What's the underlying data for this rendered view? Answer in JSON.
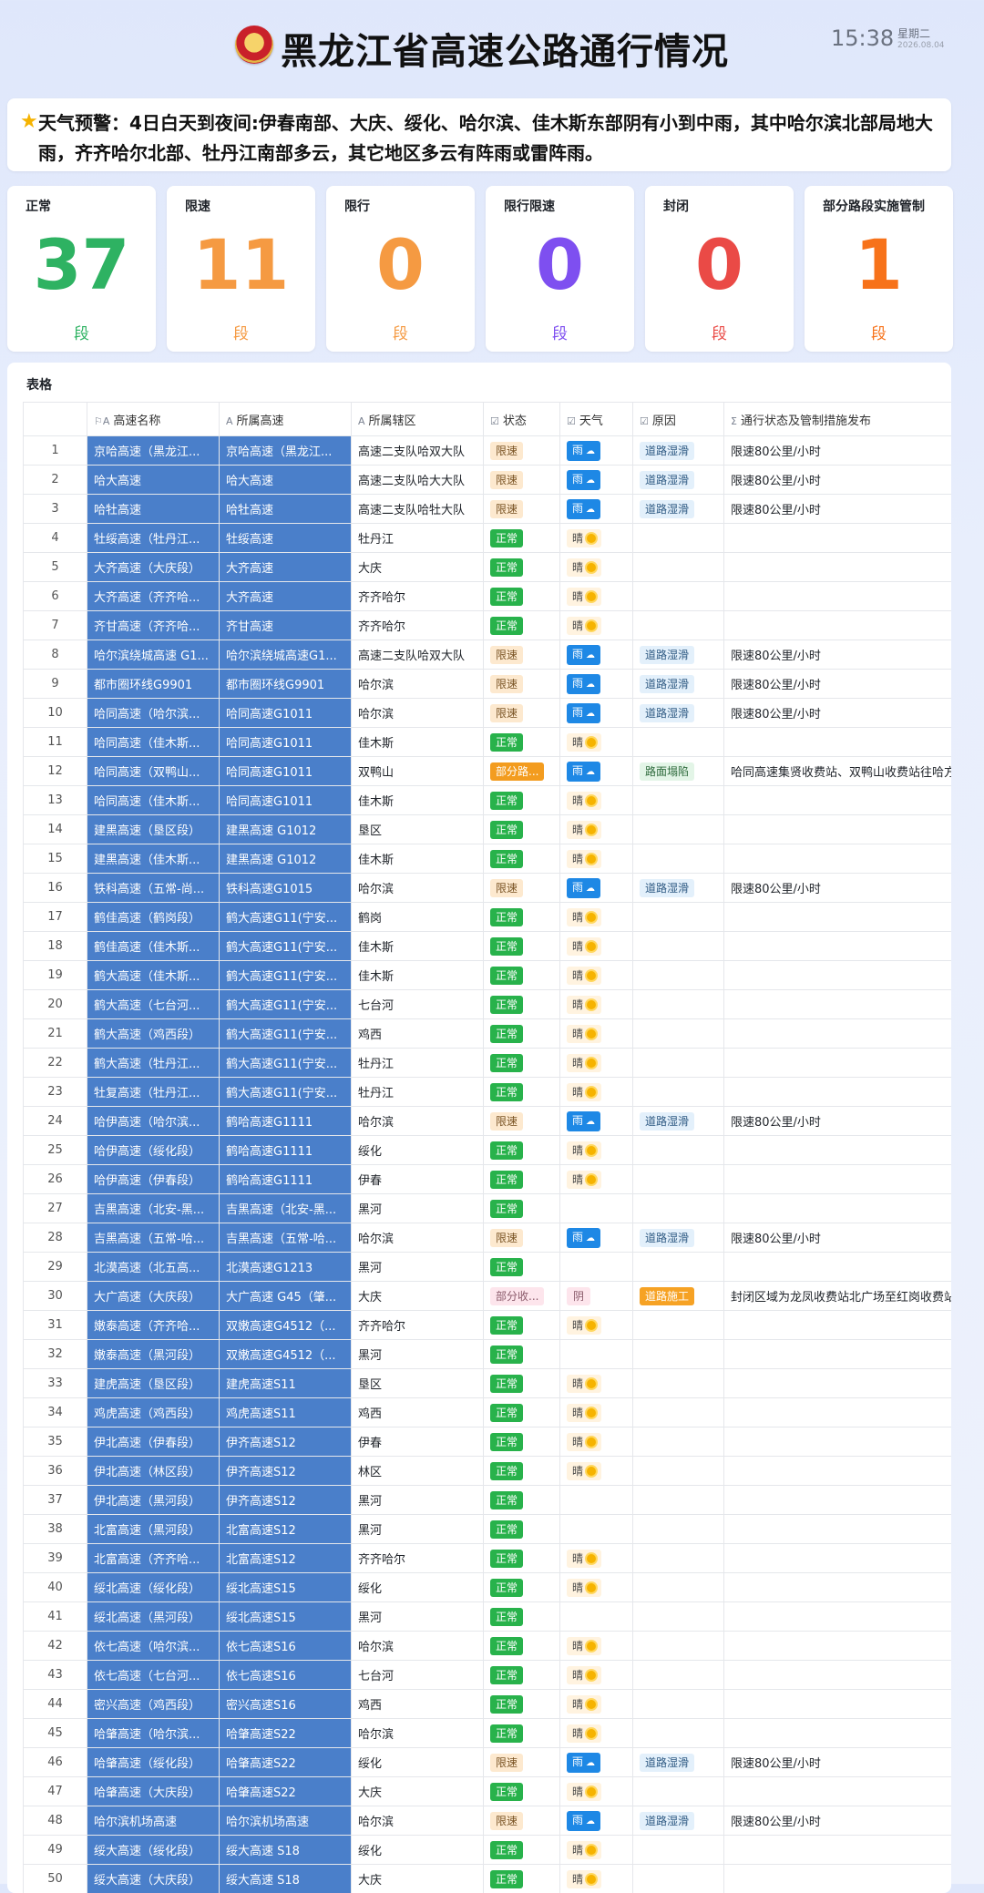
{
  "header": {
    "title": "黑龙江省高速公路通行情况",
    "time": "15:38",
    "weekday": "星期二",
    "date": "2026.08.04"
  },
  "alert": {
    "text": "天气预警：4日白天到夜间:伊春南部、大庆、绥化、哈尔滨、佳木斯东部阴有小到中雨，其中哈尔滨北部局地大雨，齐齐哈尔北部、牡丹江南部多云，其它地区多云有阵雨或雷阵雨。"
  },
  "stats": [
    {
      "label": "正常",
      "value": "37",
      "unit": "段",
      "color": "#2eb262"
    },
    {
      "label": "限速",
      "value": "11",
      "unit": "段",
      "color": "#f59a42"
    },
    {
      "label": "限行",
      "value": "0",
      "unit": "段",
      "color": "#f59a42"
    },
    {
      "label": "限行限速",
      "value": "0",
      "unit": "段",
      "color": "#7e4ff0"
    },
    {
      "label": "封闭",
      "value": "0",
      "unit": "段",
      "color": "#ea4a46"
    },
    {
      "label": "部分路段实施管制",
      "value": "1",
      "unit": "段",
      "color": "#f7721a"
    }
  ],
  "table": {
    "title": "表格",
    "headers": [
      "高速名称",
      "所属高速",
      "所属辖区",
      "状态",
      "天气",
      "原因",
      "通行状态及管制措施发布"
    ],
    "rows": [
      [
        "1",
        "京哈高速（黑龙江...",
        "京哈高速（黑龙江...",
        "高速二支队哈双大队",
        "限速",
        "雨",
        "道路湿滑",
        "限速80公里/小时"
      ],
      [
        "2",
        "哈大高速",
        "哈大高速",
        "高速二支队哈大大队",
        "限速",
        "雨",
        "道路湿滑",
        "限速80公里/小时"
      ],
      [
        "3",
        "哈牡高速",
        "哈牡高速",
        "高速二支队哈牡大队",
        "限速",
        "雨",
        "道路湿滑",
        "限速80公里/小时"
      ],
      [
        "4",
        "牡绥高速（牡丹江...",
        "牡绥高速",
        "牡丹江",
        "正常",
        "晴",
        "",
        ""
      ],
      [
        "5",
        "大齐高速（大庆段）",
        "大齐高速",
        "大庆",
        "正常",
        "晴",
        "",
        ""
      ],
      [
        "6",
        "大齐高速（齐齐哈...",
        "大齐高速",
        "齐齐哈尔",
        "正常",
        "晴",
        "",
        ""
      ],
      [
        "7",
        "齐甘高速（齐齐哈...",
        "齐甘高速",
        "齐齐哈尔",
        "正常",
        "晴",
        "",
        ""
      ],
      [
        "8",
        "哈尔滨绕城高速 G1...",
        "哈尔滨绕城高速G1...",
        "高速二支队哈双大队",
        "限速",
        "雨",
        "道路湿滑",
        "限速80公里/小时"
      ],
      [
        "9",
        "都市圈环线G9901",
        "都市圈环线G9901",
        "哈尔滨",
        "限速",
        "雨",
        "道路湿滑",
        "限速80公里/小时"
      ],
      [
        "10",
        "哈同高速（哈尔滨...",
        "哈同高速G1011",
        "哈尔滨",
        "限速",
        "雨",
        "道路湿滑",
        "限速80公里/小时"
      ],
      [
        "11",
        "哈同高速（佳木斯...",
        "哈同高速G1011",
        "佳木斯",
        "正常",
        "晴",
        "",
        ""
      ],
      [
        "12",
        "哈同高速（双鸭山...",
        "哈同高速G1011",
        "双鸭山",
        "部分路...",
        "雨",
        "路面塌陷",
        "哈同高速集贤收费站、双鸭山收费站往哈方向"
      ],
      [
        "13",
        "哈同高速（佳木斯...",
        "哈同高速G1011",
        "佳木斯",
        "正常",
        "晴",
        "",
        ""
      ],
      [
        "14",
        "建黑高速（垦区段）",
        "建黑高速 G1012",
        "垦区",
        "正常",
        "晴",
        "",
        ""
      ],
      [
        "15",
        "建黑高速（佳木斯...",
        "建黑高速 G1012",
        "佳木斯",
        "正常",
        "晴",
        "",
        ""
      ],
      [
        "16",
        "铁科高速（五常-尚...",
        "铁科高速G1015",
        "哈尔滨",
        "限速",
        "雨",
        "道路湿滑",
        "限速80公里/小时"
      ],
      [
        "17",
        "鹤佳高速（鹤岗段）",
        "鹤大高速G11(宁安...",
        "鹤岗",
        "正常",
        "晴",
        "",
        ""
      ],
      [
        "18",
        "鹤佳高速（佳木斯...",
        "鹤大高速G11(宁安...",
        "佳木斯",
        "正常",
        "晴",
        "",
        ""
      ],
      [
        "19",
        "鹤大高速（佳木斯...",
        "鹤大高速G11(宁安...",
        "佳木斯",
        "正常",
        "晴",
        "",
        ""
      ],
      [
        "20",
        "鹤大高速（七台河...",
        "鹤大高速G11(宁安...",
        "七台河",
        "正常",
        "晴",
        "",
        ""
      ],
      [
        "21",
        "鹤大高速（鸡西段）",
        "鹤大高速G11(宁安...",
        "鸡西",
        "正常",
        "晴",
        "",
        ""
      ],
      [
        "22",
        "鹤大高速（牡丹江...",
        "鹤大高速G11(宁安...",
        "牡丹江",
        "正常",
        "晴",
        "",
        ""
      ],
      [
        "23",
        "牡复高速（牡丹江...",
        "鹤大高速G11(宁安...",
        "牡丹江",
        "正常",
        "晴",
        "",
        ""
      ],
      [
        "24",
        "哈伊高速（哈尔滨...",
        "鹤哈高速G1111",
        "哈尔滨",
        "限速",
        "雨",
        "道路湿滑",
        "限速80公里/小时"
      ],
      [
        "25",
        "哈伊高速（绥化段）",
        "鹤哈高速G1111",
        "绥化",
        "正常",
        "晴",
        "",
        ""
      ],
      [
        "26",
        "哈伊高速（伊春段）",
        "鹤哈高速G1111",
        "伊春",
        "正常",
        "晴",
        "",
        ""
      ],
      [
        "27",
        "吉黑高速（北安-黑...",
        "吉黑高速（北安-黑...",
        "黑河",
        "正常",
        "",
        "",
        ""
      ],
      [
        "28",
        "吉黑高速（五常-哈...",
        "吉黑高速（五常-哈...",
        "哈尔滨",
        "限速",
        "雨",
        "道路湿滑",
        "限速80公里/小时"
      ],
      [
        "29",
        "北漠高速（北五高...",
        "北漠高速G1213",
        "黑河",
        "正常",
        "",
        "",
        ""
      ],
      [
        "30",
        "大广高速（大庆段）",
        "大广高速 G45（肇...",
        "大庆",
        "部分收...",
        "阴",
        "道路施工",
        "封闭区域为龙凤收费站北广场至红岗收费站"
      ],
      [
        "31",
        "嫩泰高速（齐齐哈...",
        "双嫩高速G4512（...",
        "齐齐哈尔",
        "正常",
        "晴",
        "",
        ""
      ],
      [
        "32",
        "嫩泰高速（黑河段）",
        "双嫩高速G4512（...",
        "黑河",
        "正常",
        "",
        "",
        ""
      ],
      [
        "33",
        "建虎高速（垦区段）",
        "建虎高速S11",
        "垦区",
        "正常",
        "晴",
        "",
        ""
      ],
      [
        "34",
        "鸡虎高速（鸡西段）",
        "鸡虎高速S11",
        "鸡西",
        "正常",
        "晴",
        "",
        ""
      ],
      [
        "35",
        "伊北高速（伊春段）",
        "伊齐高速S12",
        "伊春",
        "正常",
        "晴",
        "",
        ""
      ],
      [
        "36",
        "伊北高速（林区段）",
        "伊齐高速S12",
        "林区",
        "正常",
        "晴",
        "",
        ""
      ],
      [
        "37",
        "伊北高速（黑河段）",
        "伊齐高速S12",
        "黑河",
        "正常",
        "",
        "",
        ""
      ],
      [
        "38",
        "北富高速（黑河段）",
        "北富高速S12",
        "黑河",
        "正常",
        "",
        "",
        ""
      ],
      [
        "39",
        "北富高速（齐齐哈...",
        "北富高速S12",
        "齐齐哈尔",
        "正常",
        "晴",
        "",
        ""
      ],
      [
        "40",
        "绥北高速（绥化段）",
        "绥北高速S15",
        "绥化",
        "正常",
        "晴",
        "",
        ""
      ],
      [
        "41",
        "绥北高速（黑河段）",
        "绥北高速S15",
        "黑河",
        "正常",
        "",
        "",
        ""
      ],
      [
        "42",
        "依七高速（哈尔滨...",
        "依七高速S16",
        "哈尔滨",
        "正常",
        "晴",
        "",
        ""
      ],
      [
        "43",
        "依七高速（七台河...",
        "依七高速S16",
        "七台河",
        "正常",
        "晴",
        "",
        ""
      ],
      [
        "44",
        "密兴高速（鸡西段）",
        "密兴高速S16",
        "鸡西",
        "正常",
        "晴",
        "",
        ""
      ],
      [
        "45",
        "哈肇高速（哈尔滨...",
        "哈肇高速S22",
        "哈尔滨",
        "正常",
        "晴",
        "",
        ""
      ],
      [
        "46",
        "哈肇高速（绥化段）",
        "哈肇高速S22",
        "绥化",
        "限速",
        "雨",
        "道路湿滑",
        "限速80公里/小时"
      ],
      [
        "47",
        "哈肇高速（大庆段）",
        "哈肇高速S22",
        "大庆",
        "正常",
        "晴",
        "",
        ""
      ],
      [
        "48",
        "哈尔滨机场高速",
        "哈尔滨机场高速",
        "哈尔滨",
        "限速",
        "雨",
        "道路湿滑",
        "限速80公里/小时"
      ],
      [
        "49",
        "绥大高速（绥化段）",
        "绥大高速 S18",
        "绥化",
        "正常",
        "晴",
        "",
        ""
      ],
      [
        "50",
        "绥大高速（大庆段）",
        "绥大高速 S18",
        "大庆",
        "正常",
        "晴",
        "",
        ""
      ]
    ]
  }
}
